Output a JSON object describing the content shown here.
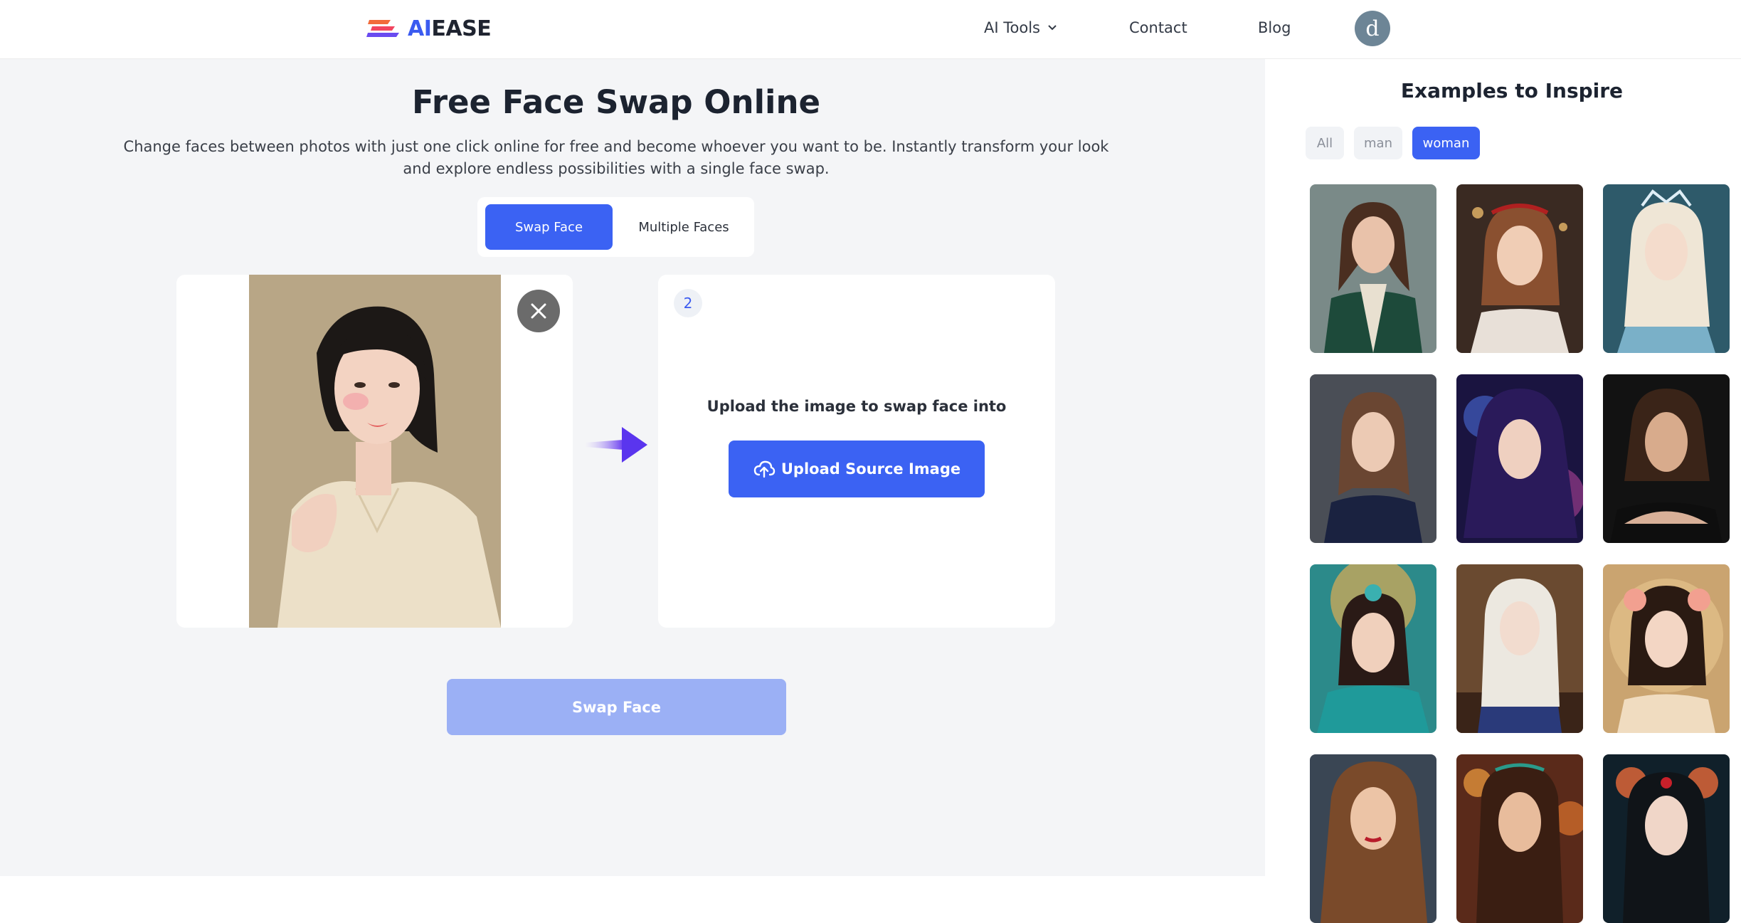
{
  "header": {
    "logo_prefix": "AI",
    "logo_suffix": "EASE",
    "nav": {
      "ai_tools": "AI Tools",
      "contact": "Contact",
      "blog": "Blog"
    },
    "avatar_initial": "d"
  },
  "main": {
    "title": "Free Face Swap Online",
    "subtitle": "Change faces between photos with just one click online for free and become whoever you want to be. Instantly transform your look and explore endless possibilities with a single face swap.",
    "tabs": [
      {
        "label": "Swap Face",
        "active": true
      },
      {
        "label": "Multiple Faces",
        "active": false
      }
    ],
    "source_panel": {
      "step": "2",
      "hint": "Upload the image to swap face into",
      "upload_label": "Upload Source Image"
    },
    "swap_button": "Swap Face"
  },
  "examples": {
    "title": "Examples to Inspire",
    "filters": [
      {
        "label": "All",
        "active": false
      },
      {
        "label": "man",
        "active": false
      },
      {
        "label": "woman",
        "active": true
      }
    ]
  },
  "colors": {
    "primary": "#3b62f3",
    "primary_disabled": "#9bb0f5",
    "background": "#f4f5f7"
  }
}
